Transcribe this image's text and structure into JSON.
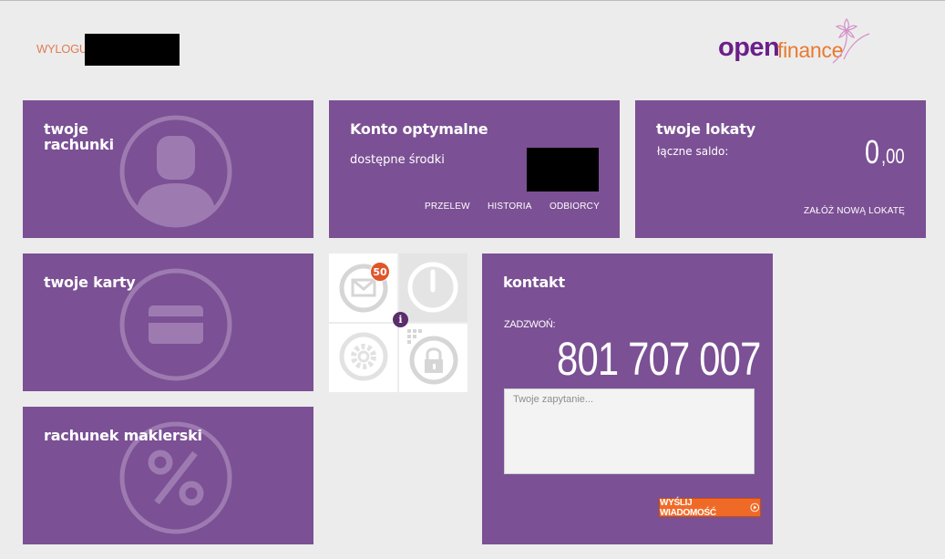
{
  "header": {
    "logout_label": "WYLOGUJ",
    "logo": {
      "part1": "open",
      "part2": "finance"
    }
  },
  "tiles": {
    "accounts": {
      "title_line1": "twoje",
      "title_line2": "rachunki",
      "icon": "person-icon"
    },
    "optimal": {
      "title": "Konto optymalne",
      "available_label": "dostępne środki",
      "links": [
        "PRZELEW",
        "HISTORIA",
        "ODBIORCY"
      ]
    },
    "deposits": {
      "title": "twoje lokaty",
      "balance_label": "łączne saldo:",
      "balance_int": "0",
      "balance_dec": ",00",
      "new_deposit_label": "ZAŁÓŻ NOWĄ LOKATĘ"
    },
    "cards": {
      "title": "twoje karty",
      "icon": "credit-card-icon"
    },
    "brokerage": {
      "title": "rachunek maklerski",
      "icon": "percent-icon"
    },
    "contact": {
      "title": "kontakt",
      "call_label": "ZADZWOŃ:",
      "phone": "801 707 007",
      "query_placeholder": "Twoje zapytanie...",
      "send_label": "WYŚLIJ WIADOMOŚĆ"
    }
  },
  "mini_grid": {
    "messages_badge": "50",
    "info_glyph": "i",
    "icons": [
      "mail-icon",
      "power-icon",
      "gear-icon",
      "lock-icon"
    ]
  },
  "colors": {
    "tile": "#7b5094",
    "background": "#ececec",
    "accent_orange": "#f06a27",
    "logo_purple": "#6b1f8a",
    "logo_orange": "#e97a2e"
  }
}
